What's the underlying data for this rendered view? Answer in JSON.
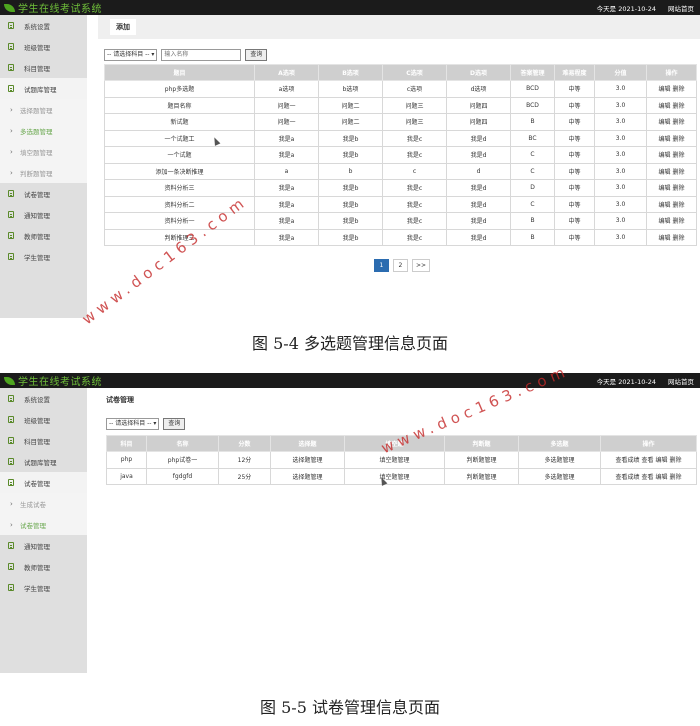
{
  "app": {
    "title": "学生在线考试系统",
    "date_text": "今天是 2021-10-24",
    "home_link": "网站首页"
  },
  "figure1": {
    "sidebar": [
      {
        "label": "系统设置",
        "kind": "main"
      },
      {
        "label": "班级管理",
        "kind": "main"
      },
      {
        "label": "科目管理",
        "kind": "main"
      },
      {
        "label": "试题库管理",
        "kind": "main",
        "active": true
      },
      {
        "label": "选择题管理",
        "kind": "sub"
      },
      {
        "label": "多选题管理",
        "kind": "sub",
        "highlight": true
      },
      {
        "label": "填空题管理",
        "kind": "sub"
      },
      {
        "label": "判断题管理",
        "kind": "sub"
      },
      {
        "label": "试卷管理",
        "kind": "main"
      },
      {
        "label": "通知管理",
        "kind": "main"
      },
      {
        "label": "教师管理",
        "kind": "main"
      },
      {
        "label": "学生管理",
        "kind": "main"
      }
    ],
    "tab_label": "添加",
    "filter": {
      "subject_select": "-- 请选择科目 --",
      "name_placeholder": "输入名称",
      "query_button": "查询"
    },
    "table": {
      "columns": [
        "题目",
        "A选项",
        "B选项",
        "C选项",
        "D选项",
        "答案管理",
        "难易程度",
        "分值",
        "操作"
      ],
      "rows": [
        [
          "php多选题",
          "a选项",
          "b选项",
          "c选项",
          "d选项",
          "BCD",
          "中等",
          "3.0"
        ],
        [
          "题目名称",
          "问题一",
          "问题二",
          "问题三",
          "问题四",
          "BCD",
          "中等",
          "3.0"
        ],
        [
          "新试题",
          "问题一",
          "问题二",
          "问题三",
          "问题四",
          "B",
          "中等",
          "3.0"
        ],
        [
          "一个试题工",
          "我是a",
          "我是b",
          "我是c",
          "我是d",
          "BC",
          "中等",
          "3.0"
        ],
        [
          "一个试题",
          "我是a",
          "我是b",
          "我是c",
          "我是d",
          "C",
          "中等",
          "3.0"
        ],
        [
          "添加一条决断推理",
          "a",
          "b",
          "c",
          "d",
          "C",
          "中等",
          "3.0"
        ],
        [
          "资料分析三",
          "我是a",
          "我是b",
          "我是c",
          "我是d",
          "D",
          "中等",
          "3.0"
        ],
        [
          "资料分析二",
          "我是a",
          "我是b",
          "我是c",
          "我是d",
          "C",
          "中等",
          "3.0"
        ],
        [
          "资料分析一",
          "我是a",
          "我是b",
          "我是c",
          "我是d",
          "B",
          "中等",
          "3.0"
        ],
        [
          "判断推理三",
          "我是a",
          "我是b",
          "我是c",
          "我是d",
          "B",
          "中等",
          "3.0"
        ]
      ],
      "op_edit": "编辑",
      "op_delete": "删除"
    },
    "pagination": [
      "1",
      "2",
      ">>"
    ],
    "caption": "图 5-4 多选题管理信息页面"
  },
  "figure2": {
    "sidebar": [
      {
        "label": "系统设置",
        "kind": "main"
      },
      {
        "label": "班级管理",
        "kind": "main"
      },
      {
        "label": "科目管理",
        "kind": "main"
      },
      {
        "label": "试题库管理",
        "kind": "main"
      },
      {
        "label": "试卷管理",
        "kind": "main",
        "active": true
      },
      {
        "label": "生成试卷",
        "kind": "sub"
      },
      {
        "label": "试卷管理",
        "kind": "sub",
        "highlight": true
      },
      {
        "label": "通知管理",
        "kind": "main"
      },
      {
        "label": "教师管理",
        "kind": "main"
      },
      {
        "label": "学生管理",
        "kind": "main"
      }
    ],
    "page_title": "试卷管理",
    "filter": {
      "subject_select": "-- 请选择科目 --",
      "query_button": "查询"
    },
    "table": {
      "columns": [
        "科目",
        "名称",
        "分数",
        "选择题",
        "填空题",
        "判断题",
        "多选题",
        "操作"
      ],
      "rows": [
        [
          "php",
          "php试卷一",
          "12分",
          "选择题管理",
          "填空题管理",
          "判断题管理",
          "多选题管理"
        ],
        [
          "java",
          "fgdgfd",
          "25分",
          "选择题管理",
          "填空题管理",
          "判断题管理",
          "多选题管理"
        ]
      ],
      "op_scores": "查看成绩",
      "op_view": "查看",
      "op_edit": "编辑",
      "op_delete": "删除"
    },
    "caption": "图 5-5 试卷管理信息页面"
  },
  "watermarks": [
    "www.doc163.com",
    "www.doc163.com"
  ]
}
